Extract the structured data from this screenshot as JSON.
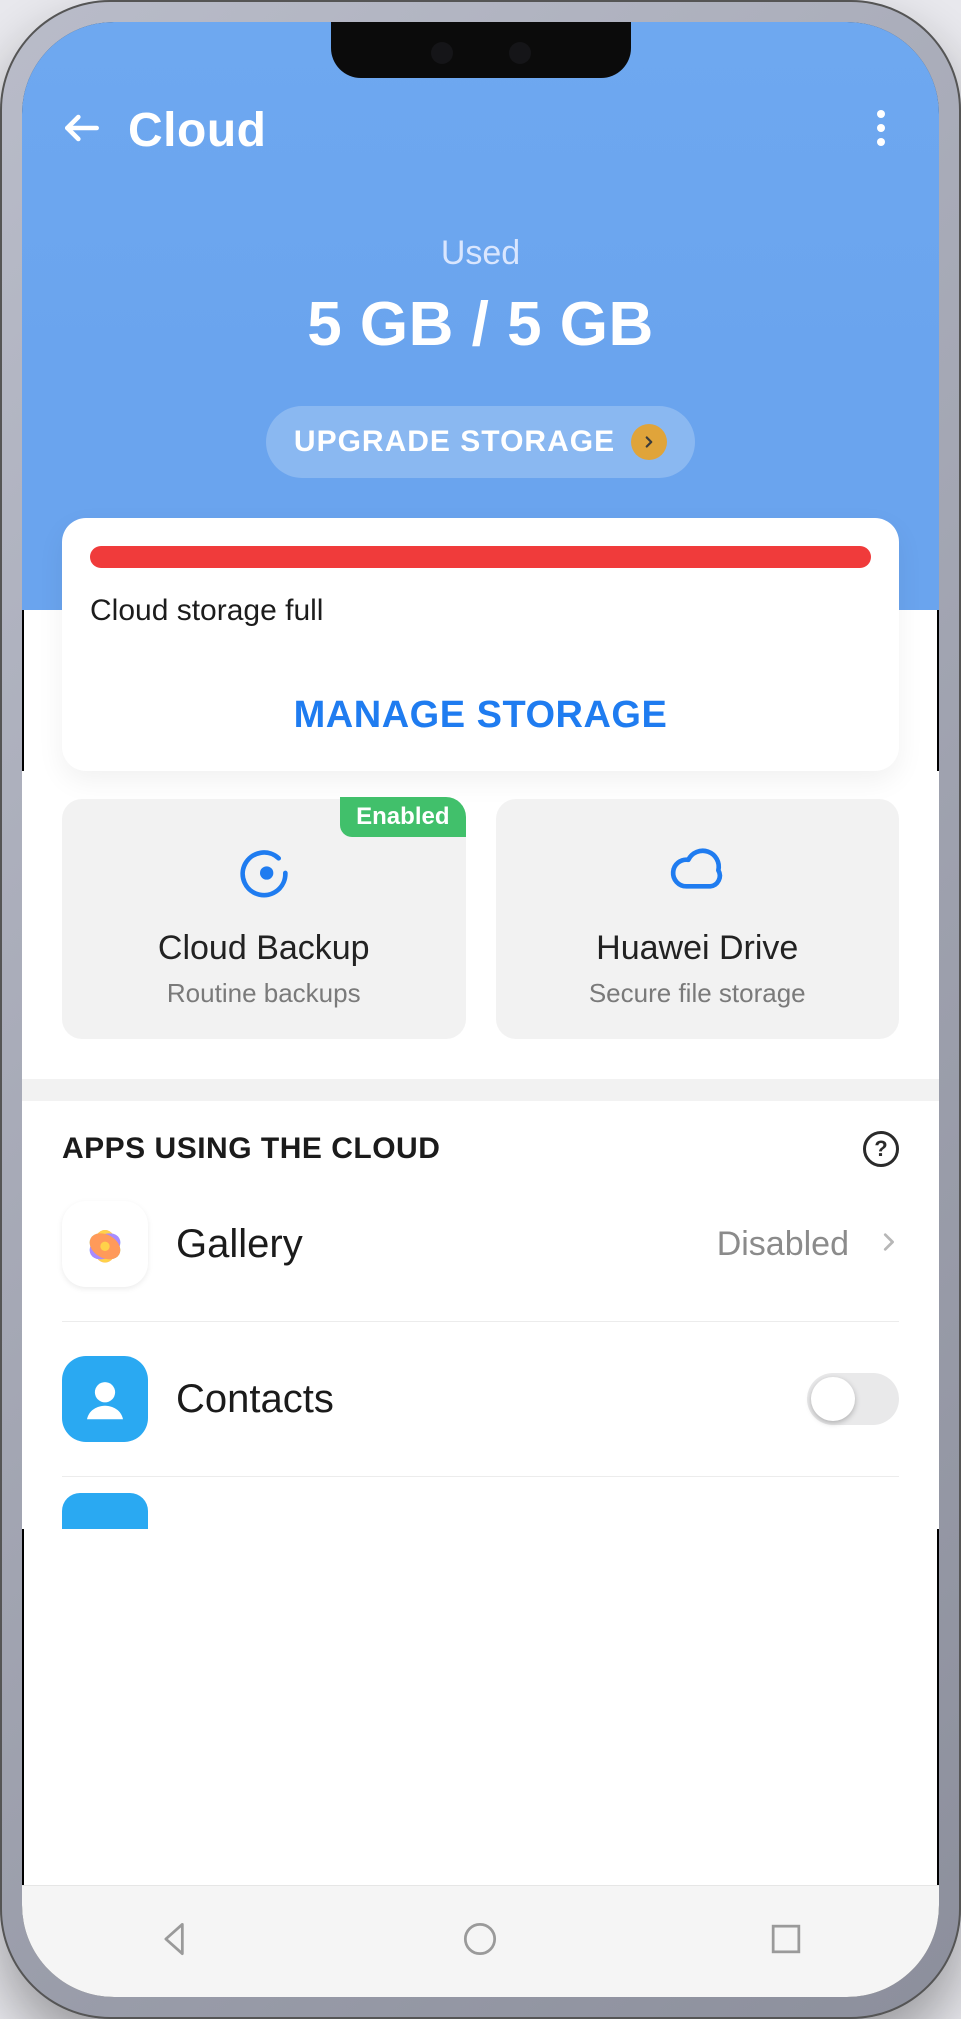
{
  "header": {
    "title": "Cloud"
  },
  "storage": {
    "used_label": "Used",
    "quota_text": "5 GB / 5 GB",
    "upgrade_label": "UPGRADE STORAGE",
    "bar_percent": 100,
    "bar_color": "#f03b3b",
    "status_text": "Cloud storage full",
    "manage_label": "MANAGE STORAGE"
  },
  "tiles": {
    "backup": {
      "title": "Cloud Backup",
      "subtitle": "Routine backups",
      "badge": "Enabled"
    },
    "drive": {
      "title": "Huawei Drive",
      "subtitle": "Secure file storage"
    }
  },
  "apps_section": {
    "heading": "APPS USING THE CLOUD",
    "items": [
      {
        "icon": "gallery-icon",
        "name": "Gallery",
        "status_text": "Disabled",
        "control": "chevron"
      },
      {
        "icon": "contacts-icon",
        "name": "Contacts",
        "toggle": false,
        "control": "toggle"
      }
    ]
  },
  "colors": {
    "accent": "#1f7cf0",
    "hero": "#6aa4ee",
    "badge_green": "#41c06b",
    "danger": "#f03b3b"
  }
}
